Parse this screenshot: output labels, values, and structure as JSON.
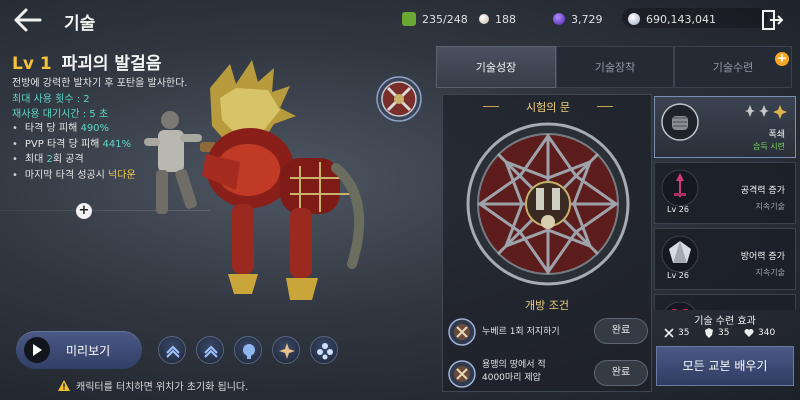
{
  "header": {
    "title": "기술"
  },
  "resources": [
    {
      "name": "energy",
      "icon": "green-gem-icon",
      "value": "235/248",
      "color": "#7fbf3f"
    },
    {
      "name": "pearl",
      "icon": "pearl-icon",
      "value": "188",
      "color": "#e8d8c8"
    },
    {
      "name": "crystal",
      "icon": "purple-orb-icon",
      "value": "3,729",
      "color": "#6b3fd1"
    },
    {
      "name": "silver",
      "icon": "silver-coin-icon",
      "value": "690,143,041",
      "color": "#c9d6e6"
    }
  ],
  "skill": {
    "level": "Lv 1",
    "name": "파괴의 발걸음",
    "description": "전방에 강력한 발차기 후 포탄을 발사한다.",
    "max_uses": "최대 사용 횟수 : 2",
    "cooldown": "재사용 대기시간 : 5 초",
    "effects": [
      {
        "prefix": "타격 당 피해 ",
        "value": "490%",
        "suffix": "",
        "hl": "cyan"
      },
      {
        "prefix": "PVP 타격 당 피해 ",
        "value": "441%",
        "suffix": "",
        "hl": "cyan"
      },
      {
        "prefix": "최대 ",
        "value": "2",
        "suffix": "회 공격",
        "hl": "cyan"
      },
      {
        "prefix": "마지막 타격 성공시 ",
        "value": "넉다운",
        "suffix": "",
        "hl": "yellow"
      }
    ]
  },
  "controls": {
    "preview_label": "미리보기",
    "slots": [
      "chevron-up-icon",
      "chevron-up-icon",
      "orb-skill-icon",
      "star-burst-icon",
      "fleur-icon"
    ],
    "notice": "캐릭터를 터치하면 위치가 초기화 됩니다."
  },
  "tabs": [
    {
      "label": "기술성장",
      "active": true
    },
    {
      "label": "기술장착",
      "active": false
    },
    {
      "label": "기술수련",
      "active": false
    }
  ],
  "trial": {
    "title": "시험의 문",
    "conditions_title": "개방 조건",
    "conditions": [
      {
        "text": "누베르 1회 저지하기",
        "button": "완료"
      },
      {
        "text": "용맹의 땅에서 적\n4000마리 제압",
        "button": "완료"
      }
    ]
  },
  "skill_list": [
    {
      "name": "폭쇄",
      "sub": "습득 시련",
      "level": ""
    },
    {
      "name": "공격력 증가",
      "sub": "지속기술",
      "level": "Lv 26"
    },
    {
      "name": "방어력 증가",
      "sub": "지속기술",
      "level": "Lv 26"
    }
  ],
  "training": {
    "title": "기술 수련 효과",
    "stats": [
      {
        "icon": "crossed-swords-icon",
        "value": "35"
      },
      {
        "icon": "shield-icon",
        "value": "35"
      },
      {
        "icon": "heart-icon",
        "value": "340"
      }
    ]
  },
  "learn_button": "모든 교본 배우기"
}
